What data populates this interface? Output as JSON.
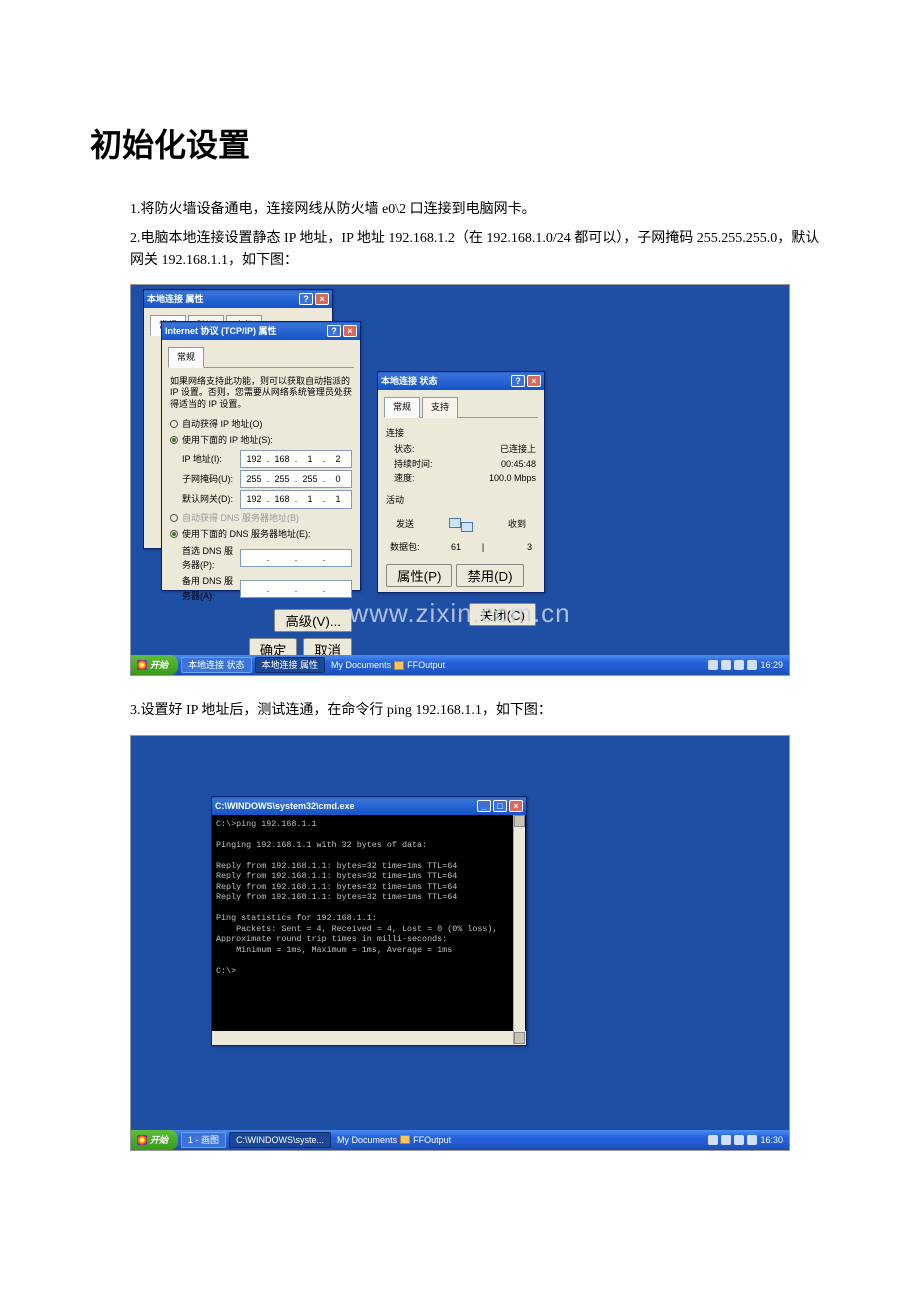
{
  "title": "初始化设置",
  "para1": "1.将防火墙设备通电，连接网线从防火墙 e0\\2 口连接到电脑网卡。",
  "para2": "2.电脑本地连接设置静态 IP 地址，IP 地址 192.168.1.2（在 192.168.1.0/24 都可以），子网掩码 255.255.255.0，默认网关 192.168.1.1，如下图：",
  "para3": "3.设置好 IP 地址后，测试连通，在命令行 ping 192.168.1.1，如下图：",
  "watermark": "www.zixin.com.cn",
  "xp": {
    "start": "开始",
    "task1_a": "本地连接 状态",
    "task1_b": "本地连接 属性",
    "task2_a": "1 - 画图",
    "task2_b": "C:\\WINDOWS\\syste...",
    "tray_docs": "My Documents",
    "tray_ff": "FFOutput",
    "time1": "16:29",
    "time2": "16:30"
  },
  "propWin": {
    "title": "本地连接 属性",
    "tab1": "常规",
    "tab2": "验证",
    "tab3": "高级"
  },
  "tcpip": {
    "title": "Internet 协议 (TCP/IP) 属性",
    "tab": "常规",
    "desc": "如果网络支持此功能，则可以获取自动指派的 IP 设置。否则，您需要从网络系统管理员处获得适当的 IP 设置。",
    "opt_auto_ip": "自动获得 IP 地址(O)",
    "opt_use_ip": "使用下面的 IP 地址(S):",
    "lbl_ip": "IP 地址(I):",
    "lbl_mask": "子网掩码(U):",
    "lbl_gw": "默认网关(D):",
    "ip": [
      "192",
      "168",
      "1",
      "2"
    ],
    "mask": [
      "255",
      "255",
      "255",
      "0"
    ],
    "gw": [
      "192",
      "168",
      "1",
      "1"
    ],
    "opt_auto_dns": "自动获得 DNS 服务器地址(B)",
    "opt_use_dns": "使用下面的 DNS 服务器地址(E):",
    "lbl_dns1": "首选 DNS 服务器(P):",
    "lbl_dns2": "备用 DNS 服务器(A):",
    "btn_adv": "高级(V)...",
    "btn_ok": "确定",
    "btn_cancel": "取消"
  },
  "status": {
    "title": "本地连接 状态",
    "tab1": "常规",
    "tab2": "支持",
    "sec_conn": "连接",
    "k_state": "状态:",
    "v_state": "已连接上",
    "k_dur": "持续时间:",
    "v_dur": "00:45:48",
    "k_speed": "速度:",
    "v_speed": "100.0 Mbps",
    "sec_act": "活动",
    "send": "发送",
    "recv": "收到",
    "k_pkt": "数据包:",
    "v_sent": "61",
    "v_recv": "3",
    "btn_prop": "属性(P)",
    "btn_disable": "禁用(D)",
    "btn_close": "关闭(C)"
  },
  "cmd": {
    "title": "C:\\WINDOWS\\system32\\cmd.exe",
    "text": "C:\\>ping 192.168.1.1\n\nPinging 192.168.1.1 with 32 bytes of data:\n\nReply from 192.168.1.1: bytes=32 time=1ms TTL=64\nReply from 192.168.1.1: bytes=32 time=1ms TTL=64\nReply from 192.168.1.1: bytes=32 time=1ms TTL=64\nReply from 192.168.1.1: bytes=32 time=1ms TTL=64\n\nPing statistics for 192.168.1.1:\n    Packets: Sent = 4, Received = 4, Lost = 0 (0% loss),\nApproximate round trip times in milli-seconds:\n    Minimum = 1ms, Maximum = 1ms, Average = 1ms\n\nC:\\>"
  }
}
